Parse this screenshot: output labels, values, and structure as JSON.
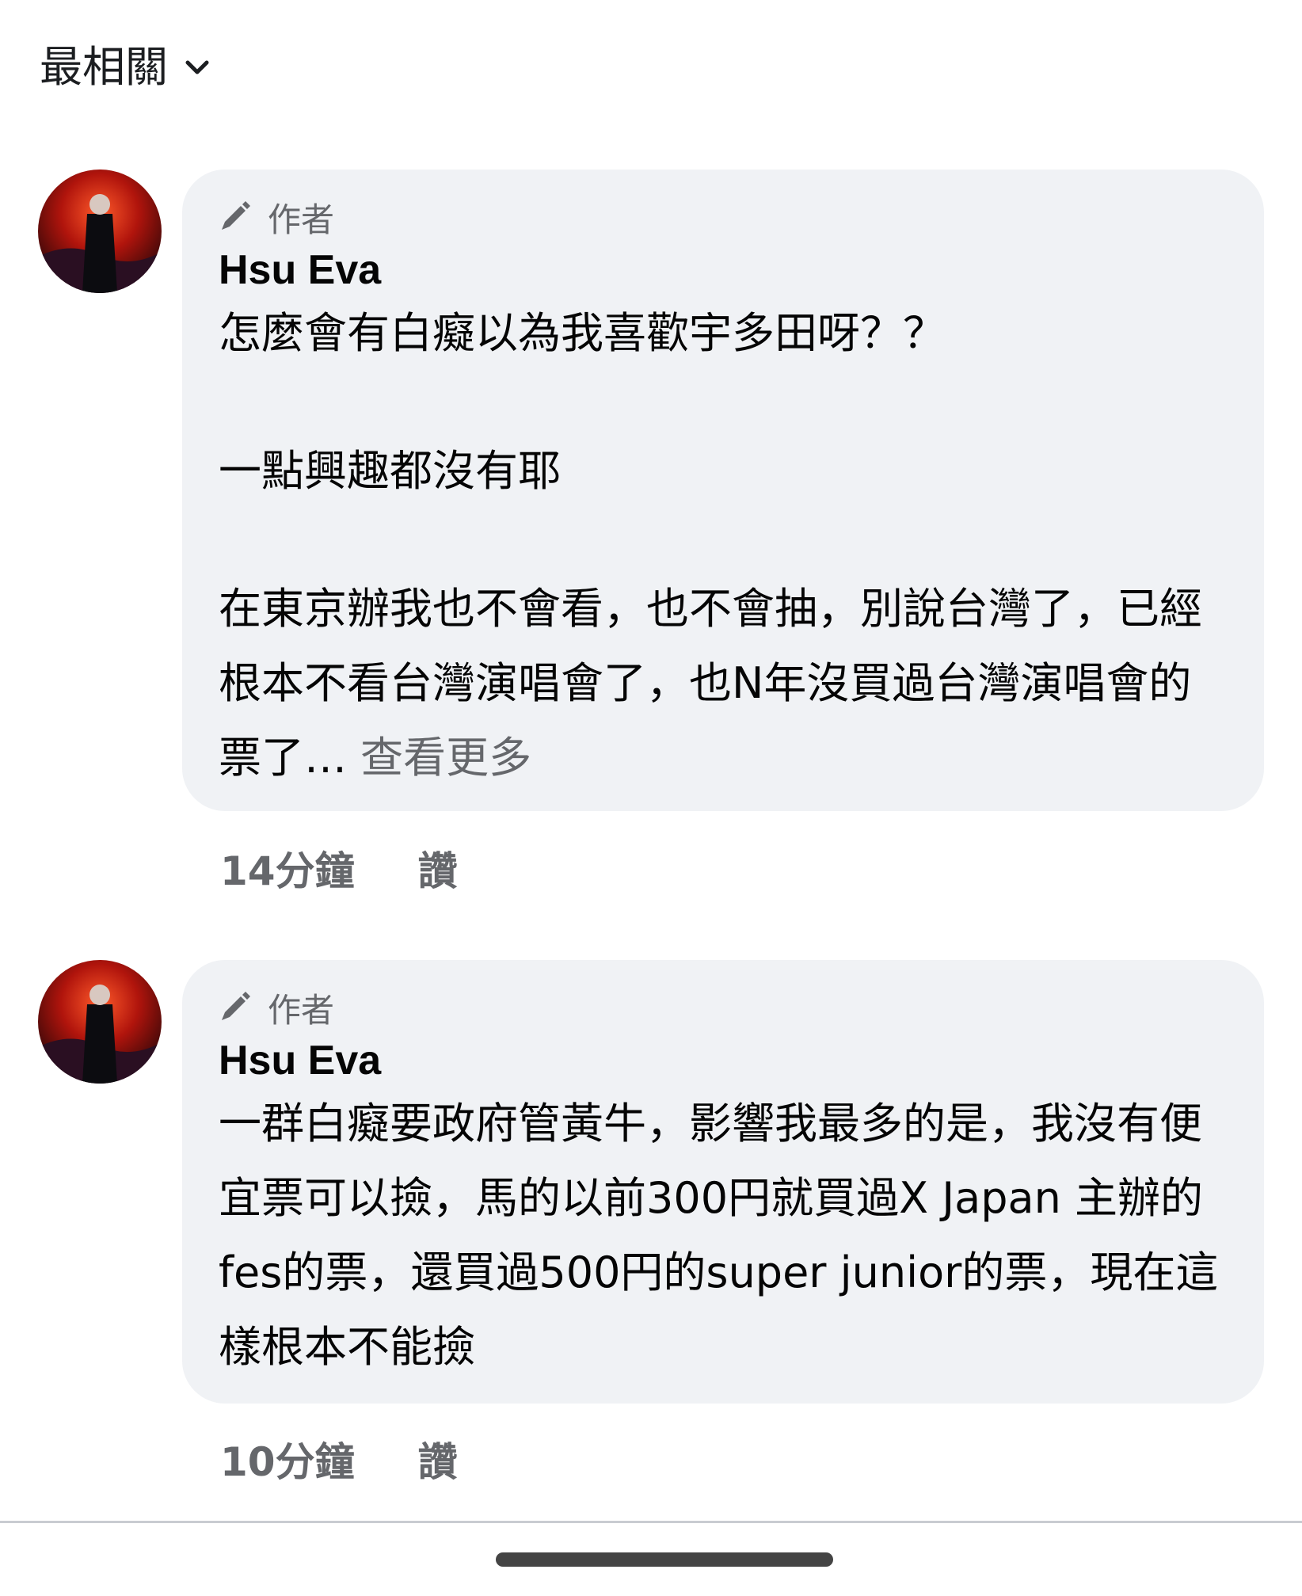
{
  "sort": {
    "label": "最相關",
    "icon": "chevron-down-icon"
  },
  "comments": [
    {
      "badge_icon": "pencil-icon",
      "badge": "作者",
      "author": "Hsu Eva",
      "paragraphs": [
        "怎麼會有白癡以為我喜歡宇多田呀？？",
        "一點興趣都沒有耶",
        "在東京辦我也不會看，也不會抽，別說台灣了，已經根本不看台灣演唱會了，也N年沒買過台灣演唱會的票了…"
      ],
      "see_more": "查看更多",
      "time": "14分鐘",
      "like": "讚"
    },
    {
      "badge_icon": "pencil-icon",
      "badge": "作者",
      "author": "Hsu Eva",
      "paragraphs": [
        "一群白癡要政府管黃牛，影響我最多的是，我沒有便宜票可以撿，馬的以前300円就買過X Japan 主辦的fes的票，還買過500円的super junior的票，現在這樣根本不能撿"
      ],
      "time": "10分鐘",
      "like": "讚"
    }
  ],
  "colors": {
    "bubble": "#f0f2f5",
    "secondary_text": "#65676b",
    "primary_text": "#050505"
  }
}
